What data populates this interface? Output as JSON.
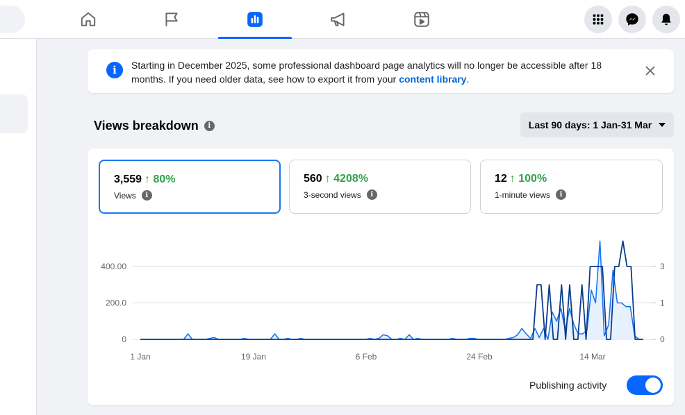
{
  "nav": {
    "tabs": [
      {
        "name": "home-icon",
        "active": false
      },
      {
        "name": "flag-icon",
        "active": false
      },
      {
        "name": "insights-icon",
        "active": true
      },
      {
        "name": "megaphone-icon",
        "active": false
      },
      {
        "name": "reels-icon",
        "active": false
      }
    ],
    "right_buttons": [
      "grid-menu-icon",
      "messenger-icon",
      "bell-icon"
    ]
  },
  "notice": {
    "text_before": "Starting in December 2025, some professional dashboard page analytics will no longer be accessible after 18 months. If you need older data, see how to export it from your ",
    "link_text": "content library",
    "text_after": "."
  },
  "views": {
    "title": "Views breakdown",
    "date_range": "Last 90 days: 1 Jan-31 Mar"
  },
  "metrics": [
    {
      "value": "3,559",
      "change": "↑ 80%",
      "label": "Views",
      "selected": true
    },
    {
      "value": "560",
      "change": "↑ 4208%",
      "label": "3-second views",
      "selected": false
    },
    {
      "value": "12",
      "change": "↑ 100%",
      "label": "1-minute views",
      "selected": false
    }
  ],
  "chart_data": {
    "type": "line",
    "x_tick_labels": [
      "1 Jan",
      "19 Jan",
      "6 Feb",
      "24 Feb",
      "14 Mar"
    ],
    "y_left_ticks": [
      "0",
      "200.0",
      "400.00"
    ],
    "y_right_ticks": [
      "0",
      "1",
      "3"
    ],
    "y_left_range": [
      0,
      400
    ],
    "y_right_range": [
      0,
      3
    ],
    "grid": true,
    "series": [
      {
        "values": [
          0,
          0,
          0,
          0,
          0,
          0,
          0,
          0,
          0,
          0,
          0,
          30,
          0,
          0,
          0,
          0,
          5,
          10,
          0,
          0,
          0,
          0,
          0,
          0,
          5,
          0,
          0,
          0,
          0,
          0,
          0,
          30,
          0,
          0,
          5,
          0,
          0,
          5,
          0,
          0,
          0,
          0,
          0,
          0,
          0,
          0,
          0,
          0,
          0,
          0,
          0,
          0,
          0,
          5,
          0,
          5,
          25,
          20,
          0,
          0,
          5,
          0,
          25,
          0,
          5,
          0,
          0,
          0,
          0,
          0,
          0,
          0,
          5,
          0,
          0,
          0,
          5,
          5,
          0,
          0,
          0,
          0,
          0,
          0,
          0,
          5,
          10,
          25,
          60,
          30,
          5,
          60,
          10,
          60,
          0,
          150,
          100,
          170,
          50,
          170,
          80,
          30,
          30,
          50,
          270,
          200,
          540,
          20,
          80,
          380,
          200,
          200,
          180,
          180,
          20,
          0,
          0
        ],
        "color": "#1877f2",
        "axis": "left",
        "filled": true
      },
      {
        "values": [
          0,
          0,
          0,
          0,
          0,
          0,
          0,
          0,
          0,
          0,
          0,
          0,
          0,
          0,
          0,
          0,
          0,
          0,
          0,
          0,
          0,
          0,
          0,
          0,
          0,
          0,
          0,
          0,
          0,
          0,
          0,
          0,
          0,
          0,
          0,
          0,
          0,
          0,
          0,
          0,
          0,
          0,
          0,
          0,
          0,
          0,
          0,
          0,
          0,
          0,
          0,
          0,
          0,
          0,
          0,
          0,
          0,
          0,
          0,
          0,
          0,
          0,
          0,
          0,
          0,
          0,
          0,
          0,
          0,
          0,
          0,
          0,
          0,
          0,
          0,
          0,
          0,
          0,
          0,
          0,
          0,
          0,
          0,
          0,
          0,
          0,
          0,
          0,
          0,
          0,
          0,
          0,
          0,
          0,
          0,
          0,
          0,
          2,
          2,
          0,
          2,
          0,
          0,
          2,
          0,
          2,
          0,
          0,
          2,
          0,
          3,
          3,
          3,
          3,
          0,
          0,
          3,
          3,
          4,
          3,
          3,
          0,
          0,
          0
        ],
        "color": "#0b3c8c",
        "axis": "right",
        "filled": false
      }
    ]
  },
  "publishing": {
    "label": "Publishing activity",
    "on": true
  }
}
